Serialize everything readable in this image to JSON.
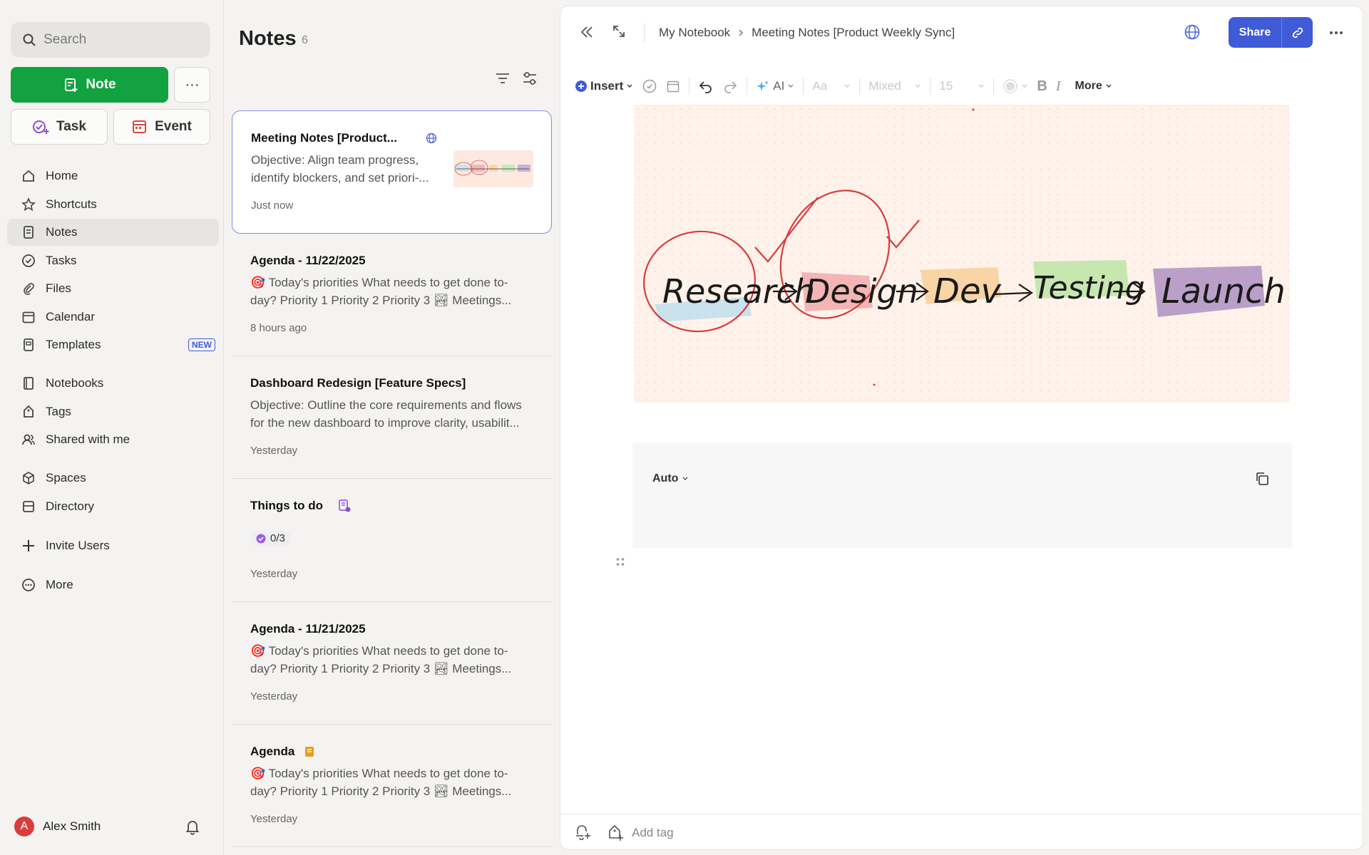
{
  "sidebar": {
    "search_placeholder": "Search",
    "note_button": "Note",
    "task_button": "Task",
    "event_button": "Event",
    "more_glyph": "···",
    "nav_main": [
      {
        "label": "Home",
        "icon": "home-icon"
      },
      {
        "label": "Shortcuts",
        "icon": "star-icon"
      },
      {
        "label": "Notes",
        "icon": "notes-icon",
        "active": true
      },
      {
        "label": "Tasks",
        "icon": "tasks-icon"
      },
      {
        "label": "Files",
        "icon": "files-icon"
      },
      {
        "label": "Calendar",
        "icon": "calendar-icon"
      },
      {
        "label": "Templates",
        "icon": "templates-icon",
        "badge": "NEW"
      }
    ],
    "nav_org": [
      {
        "label": "Notebooks",
        "icon": "notebook-icon"
      },
      {
        "label": "Tags",
        "icon": "tag-icon"
      },
      {
        "label": "Shared with me",
        "icon": "people-icon"
      }
    ],
    "nav_spaces": [
      {
        "label": "Spaces",
        "icon": "cube-icon"
      },
      {
        "label": "Directory",
        "icon": "directory-icon"
      }
    ],
    "invite": "Invite Users",
    "more": "More",
    "user": {
      "name": "Alex Smith",
      "initial": "A"
    }
  },
  "notes_list": {
    "title": "Notes",
    "count": "6",
    "cards": [
      {
        "title": "Meeting Notes [Product...",
        "body": "Objective: Align team progress, identify blockers, and set priori-...",
        "time": "Just now"
      },
      {
        "title": "Agenda - 11/22/2025",
        "body": "🎯 Today's priorities What needs to get done to-day? Priority 1 Priority 2 Priority 3 🏞 Meetings...",
        "time": "8 hours ago"
      },
      {
        "title": "Dashboard Redesign [Feature Specs]",
        "body": "Objective: Outline the core requirements and flows for the new dashboard to improve clarity, usabilit...",
        "time": "Yesterday"
      },
      {
        "title": "Things to do",
        "progress": "0/3",
        "time": "Yesterday"
      },
      {
        "title": "Agenda - 11/21/2025",
        "body": "🎯 Today's priorities What needs to get done to-day? Priority 1 Priority 2 Priority 3 🏞 Meetings...",
        "time": "Yesterday"
      },
      {
        "title": "Agenda",
        "body": "🎯 Today's priorities What needs to get done to-day? Priority 1 Priority 2 Priority 3 🏞 Meetings...",
        "time": "Yesterday"
      }
    ]
  },
  "editor": {
    "breadcrumb": {
      "notebook": "My Notebook",
      "note": "Meeting Notes [Product Weekly Sync]"
    },
    "share": "Share",
    "toolbar": {
      "insert": "Insert",
      "ai": "AI",
      "font": "Aa",
      "style": "Mixed",
      "size": "15",
      "bold": "B",
      "italic": "I",
      "more": "More"
    },
    "sketch_words": [
      "Research",
      "Design",
      "Dev",
      "Testing",
      "Launch"
    ],
    "code_language": "Auto",
    "add_tag": "Add tag"
  },
  "colors": {
    "accent": "#3f5bd8",
    "note_green": "#12a23f",
    "avatar": "#d93c3c"
  }
}
